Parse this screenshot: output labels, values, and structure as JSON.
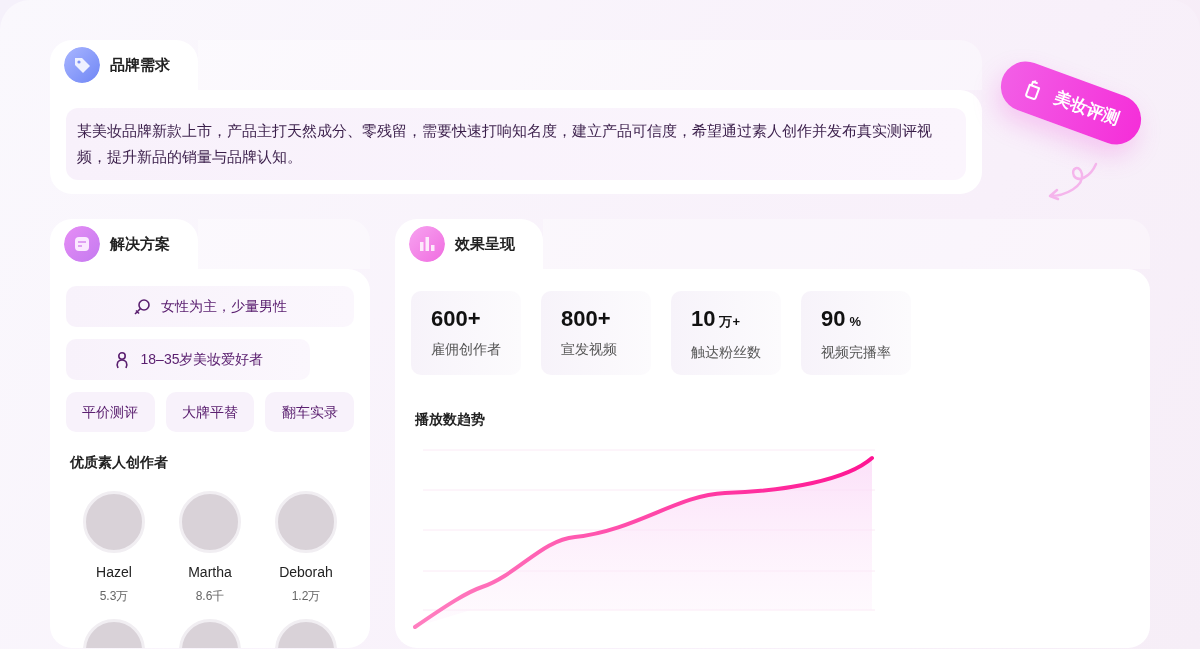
{
  "brand_need": {
    "title": "品牌需求",
    "description": "某美妆品牌新款上市，产品主打天然成分、零残留，需要快速打响知名度，建立产品可信度，希望通过素人创作并发布真实测评视频，提升新品的销量与品牌认知。"
  },
  "sticker": {
    "label": "美妆评测"
  },
  "solution": {
    "title": "解决方案",
    "audience": [
      {
        "kind": "gender",
        "text": "女性为主，少量男性"
      },
      {
        "kind": "age",
        "text": "18–35岁美妆爱好者"
      }
    ],
    "tags": [
      "平价测评",
      "大牌平替",
      "翻车实录"
    ],
    "creators_title": "优质素人创作者",
    "creators": [
      {
        "kind": "photo",
        "name": "Hazel",
        "followers": "5.3万"
      },
      {
        "kind": "photo",
        "name": "Martha",
        "followers": "8.6千"
      },
      {
        "kind": "photo",
        "name": "Deborah",
        "followers": "1.2万"
      },
      {
        "kind": "photo"
      },
      {
        "kind": "photo"
      },
      {
        "kind": "photo"
      }
    ]
  },
  "results": {
    "title": "效果呈现",
    "stats": [
      {
        "value": "600+",
        "label": "雇佣创作者"
      },
      {
        "value": "800+",
        "label": "宣发视频"
      },
      {
        "value": "10",
        "unit": "万+",
        "label": "触达粉丝数"
      },
      {
        "value": "90",
        "unit": "%",
        "label": "视频完播率"
      }
    ],
    "trend": {
      "title": "播放数趋势"
    }
  }
}
